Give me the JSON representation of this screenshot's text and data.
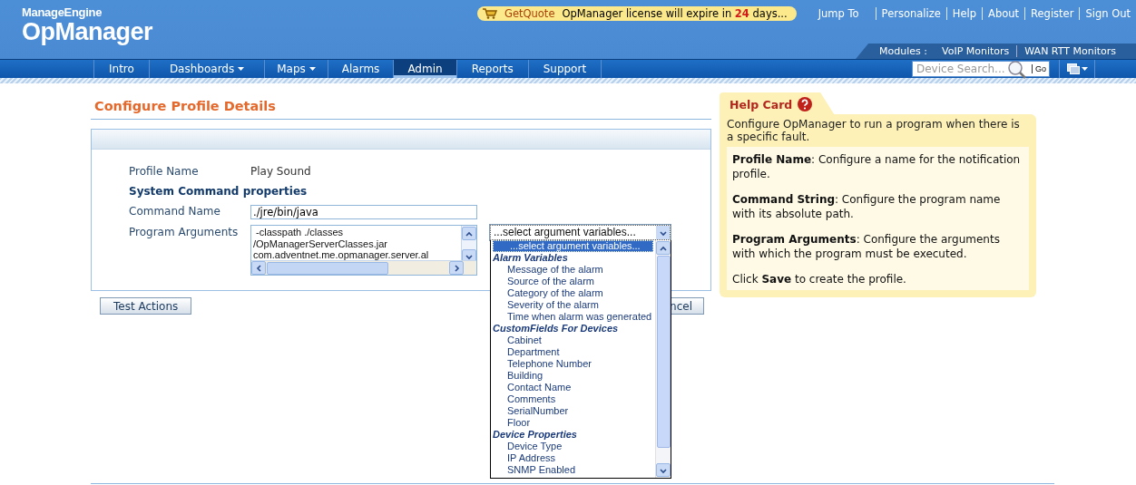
{
  "header": {
    "brand_top": "ManageEngine",
    "brand": "OpManager",
    "quote": {
      "label": "GetQuote",
      "message_before": "OpManager license will expire in",
      "days": "24",
      "message_after": "days..."
    },
    "links": [
      "Jump To",
      "Personalize",
      "Help",
      "About",
      "Register",
      "Sign Out"
    ],
    "modules": {
      "label": "Modules :",
      "items": [
        "VoIP Monitors",
        "WAN RTT Monitors"
      ]
    }
  },
  "nav": [
    {
      "label": "Intro",
      "has_menu": false,
      "selected": false
    },
    {
      "label": "Dashboards",
      "has_menu": true,
      "selected": false
    },
    {
      "label": "Maps",
      "has_menu": true,
      "selected": false
    },
    {
      "label": "Alarms",
      "has_menu": false,
      "selected": false
    },
    {
      "label": "Admin",
      "has_menu": false,
      "selected": true
    },
    {
      "label": "Reports",
      "has_menu": false,
      "selected": false
    },
    {
      "label": "Support",
      "has_menu": false,
      "selected": false
    }
  ],
  "search": {
    "placeholder": "Device Search...",
    "go": "Go"
  },
  "page_title": "Configure Profile Details",
  "form": {
    "profile_label": "Profile Name",
    "profile_value": "Play Sound",
    "section": "System Command properties",
    "command_label": "Command Name",
    "command_value": "./jre/bin/java",
    "arguments_label": "Program Arguments",
    "arguments_lines": [
      " -classpath ./classes",
      "/OpManagerServerClasses.jar",
      "com.adventnet.me.opmanager.server.al"
    ],
    "select_value": "...select argument variables...",
    "options": [
      {
        "kind": "option",
        "label": "...select argument variables...",
        "selected": true
      },
      {
        "kind": "group",
        "label": "Alarm Variables",
        "selected": false
      },
      {
        "kind": "option",
        "label": "Message of the alarm",
        "selected": false
      },
      {
        "kind": "option",
        "label": "Source of the alarm",
        "selected": false
      },
      {
        "kind": "option",
        "label": "Category of the alarm",
        "selected": false
      },
      {
        "kind": "option",
        "label": "Severity of the alarm",
        "selected": false
      },
      {
        "kind": "option",
        "label": "Time when alarm was generated",
        "selected": false
      },
      {
        "kind": "group",
        "label": "CustomFields For Devices",
        "selected": false
      },
      {
        "kind": "option",
        "label": "Cabinet",
        "selected": false
      },
      {
        "kind": "option",
        "label": "Department",
        "selected": false
      },
      {
        "kind": "option",
        "label": "Telephone Number",
        "selected": false
      },
      {
        "kind": "option",
        "label": "Building",
        "selected": false
      },
      {
        "kind": "option",
        "label": "Contact Name",
        "selected": false
      },
      {
        "kind": "option",
        "label": "Comments",
        "selected": false
      },
      {
        "kind": "option",
        "label": "SerialNumber",
        "selected": false
      },
      {
        "kind": "option",
        "label": "Floor",
        "selected": false
      },
      {
        "kind": "group",
        "label": "Device Properties",
        "selected": false
      },
      {
        "kind": "option",
        "label": "Device Type",
        "selected": false
      },
      {
        "kind": "option",
        "label": "IP Address",
        "selected": false
      },
      {
        "kind": "option",
        "label": "SNMP Enabled",
        "selected": false
      }
    ],
    "buttons": [
      "Test Actions",
      "ncel"
    ]
  },
  "help": {
    "title": "Help Card",
    "intro": "Configure OpManager to run a program when there is a specific fault.",
    "paragraphs": [
      "**Profile Name**: Configure a name for the notification profile.",
      "**Command String**: Configure the program name with its absolute path.",
      "**Program Arguments**: Configure the arguments with which the program must be executed.",
      "Click **Save** to create the profile."
    ]
  }
}
